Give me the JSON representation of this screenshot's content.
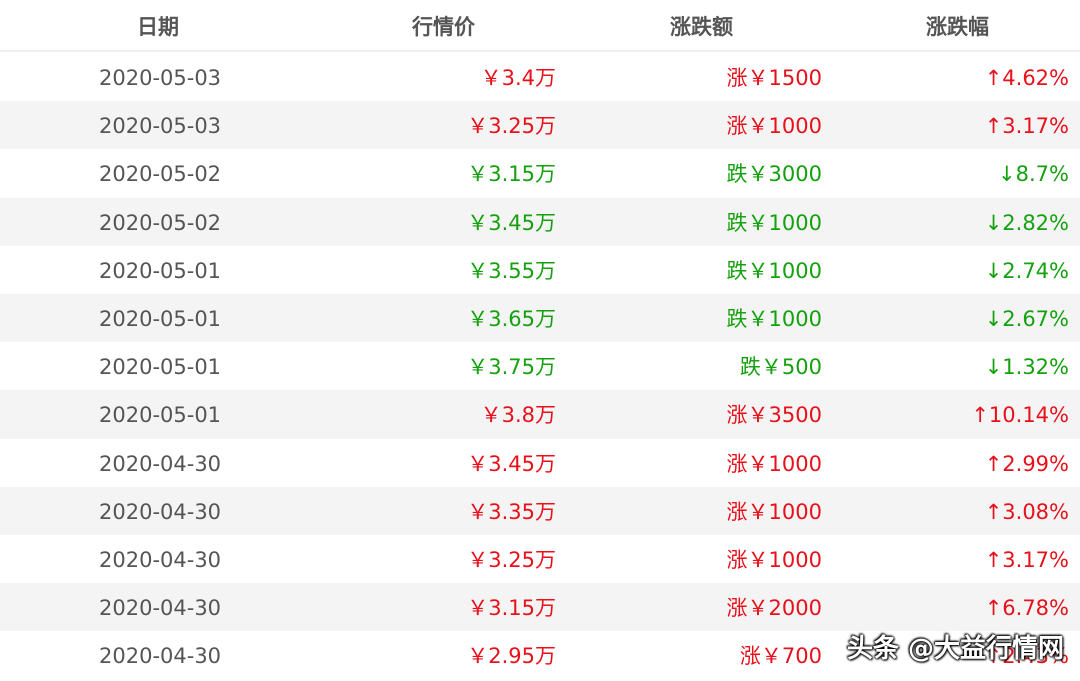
{
  "colors": {
    "up": "#e8101a",
    "down": "#14a10e",
    "header_text": "#555555",
    "alt_row": "#f4f4f4"
  },
  "headers": {
    "date": "日期",
    "price": "行情价",
    "change": "涨跌额",
    "pct": "涨跌幅"
  },
  "rows": [
    {
      "date": "2020-05-03",
      "price": "￥3.4万",
      "change": "涨￥1500",
      "pct": "↑4.62%",
      "dir": "up"
    },
    {
      "date": "2020-05-03",
      "price": "￥3.25万",
      "change": "涨￥1000",
      "pct": "↑3.17%",
      "dir": "up"
    },
    {
      "date": "2020-05-02",
      "price": "￥3.15万",
      "change": "跌￥3000",
      "pct": "↓8.7%",
      "dir": "down"
    },
    {
      "date": "2020-05-02",
      "price": "￥3.45万",
      "change": "跌￥1000",
      "pct": "↓2.82%",
      "dir": "down"
    },
    {
      "date": "2020-05-01",
      "price": "￥3.55万",
      "change": "跌￥1000",
      "pct": "↓2.74%",
      "dir": "down"
    },
    {
      "date": "2020-05-01",
      "price": "￥3.65万",
      "change": "跌￥1000",
      "pct": "↓2.67%",
      "dir": "down"
    },
    {
      "date": "2020-05-01",
      "price": "￥3.75万",
      "change": "跌￥500",
      "pct": "↓1.32%",
      "dir": "down"
    },
    {
      "date": "2020-05-01",
      "price": "￥3.8万",
      "change": "涨￥3500",
      "pct": "↑10.14%",
      "dir": "up"
    },
    {
      "date": "2020-04-30",
      "price": "￥3.45万",
      "change": "涨￥1000",
      "pct": "↑2.99%",
      "dir": "up"
    },
    {
      "date": "2020-04-30",
      "price": "￥3.35万",
      "change": "涨￥1000",
      "pct": "↑3.08%",
      "dir": "up"
    },
    {
      "date": "2020-04-30",
      "price": "￥3.25万",
      "change": "涨￥1000",
      "pct": "↑3.17%",
      "dir": "up"
    },
    {
      "date": "2020-04-30",
      "price": "￥3.15万",
      "change": "涨￥2000",
      "pct": "↑6.78%",
      "dir": "up"
    },
    {
      "date": "2020-04-30",
      "price": "￥2.95万",
      "change": "涨￥700",
      "pct": "↑2.43%",
      "dir": "up"
    }
  ],
  "watermark": "头条 @大益行情网"
}
